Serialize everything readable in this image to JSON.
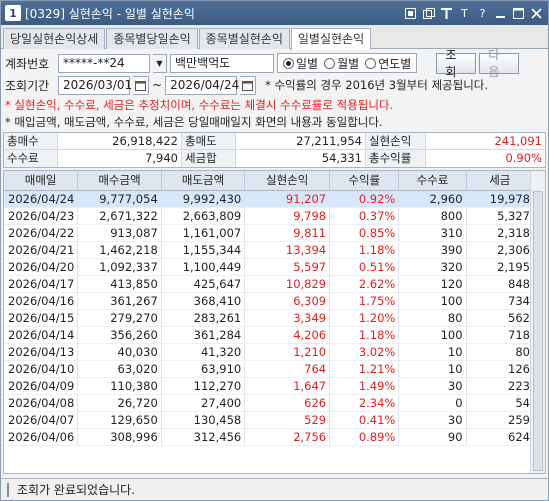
{
  "window": {
    "number": "1",
    "title": "[0329] 실현손익 - 일별 실현손익",
    "icons": [
      "restore-icon",
      "copy-icon",
      "pin-icon",
      "font-icon",
      "help-icon",
      "minimize-icon",
      "maximize-icon",
      "close-icon"
    ],
    "icon_glyphs": {
      "font": "T",
      "help": "?"
    }
  },
  "tabs": [
    {
      "label": "당일실현손익상세",
      "active": false
    },
    {
      "label": "종목별당일손익",
      "active": false
    },
    {
      "label": "종목별실현손익",
      "active": false
    },
    {
      "label": "일별실현손익",
      "active": true
    }
  ],
  "form": {
    "account_label": "계좌번호",
    "account_value": "*****-**24",
    "account_name": "백만백억도",
    "radio": [
      {
        "label": "일별",
        "checked": true
      },
      {
        "label": "월별",
        "checked": false
      },
      {
        "label": "연도별",
        "checked": false
      }
    ],
    "query_button": "조회",
    "next_button": "다음",
    "period_label": "조회기간",
    "date_from": "2026/03/01",
    "date_sep": "~",
    "date_to": "2026/04/24",
    "note1": "* 수익률의 경우 2016년 3월부터 제공됩니다.",
    "note2": "* 실현손익, 수수료, 세금은 추정치이며, 수수료는 체결시 수수료률로 적용됩니다.",
    "note3": "* 매입금액, 매도금액, 수수료, 세금은 당일매매일지 화면의 내용과 동일합니다."
  },
  "summary": {
    "total_buy_label": "총매수",
    "total_buy": "26,918,422",
    "total_sell_label": "총매도",
    "total_sell": "27,211,954",
    "realized_label": "실현손익",
    "realized": "241,091",
    "fee_label": "수수료",
    "fee": "7,940",
    "tax_label": "세금합",
    "tax": "54,331",
    "return_label": "총수익률",
    "return": "0.90%"
  },
  "table": {
    "columns": [
      "매매일",
      "매수금액",
      "매도금액",
      "실현손익",
      "수익률",
      "수수료",
      "세금"
    ],
    "rows": [
      [
        "2026/04/24",
        "9,777,054",
        "9,992,430",
        "91,207",
        "0.92%",
        "2,960",
        "19,978"
      ],
      [
        "2026/04/23",
        "2,671,322",
        "2,663,809",
        "9,798",
        "0.37%",
        "800",
        "5,327"
      ],
      [
        "2026/04/22",
        "913,087",
        "1,161,007",
        "9,811",
        "0.85%",
        "310",
        "2,318"
      ],
      [
        "2026/04/21",
        "1,462,218",
        "1,155,344",
        "13,394",
        "1.18%",
        "390",
        "2,306"
      ],
      [
        "2026/04/20",
        "1,092,337",
        "1,100,449",
        "5,597",
        "0.51%",
        "320",
        "2,195"
      ],
      [
        "2026/04/17",
        "413,850",
        "425,647",
        "10,829",
        "2.62%",
        "120",
        "848"
      ],
      [
        "2026/04/16",
        "361,267",
        "368,410",
        "6,309",
        "1.75%",
        "100",
        "734"
      ],
      [
        "2026/04/15",
        "279,270",
        "283,261",
        "3,349",
        "1.20%",
        "80",
        "562"
      ],
      [
        "2026/04/14",
        "356,260",
        "361,284",
        "4,206",
        "1.18%",
        "100",
        "718"
      ],
      [
        "2026/04/13",
        "40,030",
        "41,320",
        "1,210",
        "3.02%",
        "10",
        "80"
      ],
      [
        "2026/04/10",
        "63,020",
        "63,910",
        "764",
        "1.21%",
        "10",
        "126"
      ],
      [
        "2026/04/09",
        "110,380",
        "112,270",
        "1,647",
        "1.49%",
        "30",
        "223"
      ],
      [
        "2026/04/08",
        "26,720",
        "27,400",
        "626",
        "2.34%",
        "0",
        "54"
      ],
      [
        "2026/04/07",
        "129,650",
        "130,458",
        "529",
        "0.41%",
        "30",
        "259"
      ],
      [
        "2026/04/06",
        "308,996",
        "312,456",
        "2,756",
        "0.89%",
        "90",
        "624"
      ]
    ],
    "selected_row": 0
  },
  "status": {
    "message": "조회가 완료되었습니다."
  },
  "colors": {
    "profit": "#e02020",
    "selection": "#d7e7fa",
    "title_bar": "#3d5c84"
  }
}
